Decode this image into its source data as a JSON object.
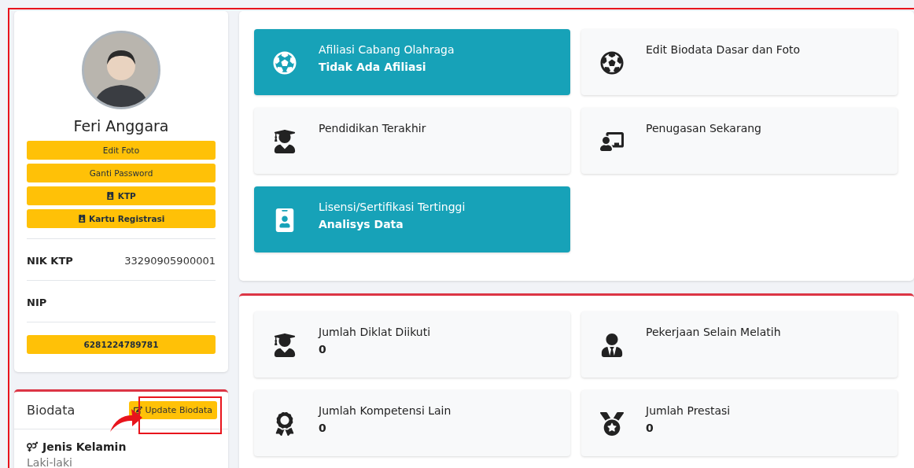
{
  "profile": {
    "name": "Feri Anggara",
    "buttons": [
      {
        "label": "Edit Foto",
        "kind": "plain"
      },
      {
        "label": "Ganti Password",
        "kind": "plain"
      },
      {
        "label": "KTP",
        "kind": "card"
      },
      {
        "label": "Kartu Registrasi",
        "kind": "card"
      }
    ],
    "fields": [
      {
        "label": "NIK KTP",
        "value": "33290905900001"
      },
      {
        "label": "NIP"
      }
    ],
    "phone": "6281224789781"
  },
  "biodata": {
    "title": "Biodata",
    "update_button": "Update Biodata",
    "items": [
      {
        "label": "Jenis Kelamin",
        "value": "Laki-laki"
      }
    ]
  },
  "summary_tiles": [
    {
      "title": "Afiliasi Cabang Olahraga",
      "value": "Tidak Ada Afiliasi",
      "highlighted": true
    },
    {
      "title": "Edit Biodata Dasar dan Foto",
      "highlighted": false
    },
    {
      "title": "Pendidikan Terakhir",
      "highlighted": false
    },
    {
      "title": "Penugasan Sekarang",
      "highlighted": false
    },
    {
      "title": "Lisensi/Sertifikasi Tertinggi",
      "value": "Analisys Data",
      "highlighted": true
    }
  ],
  "stat_tiles": [
    {
      "title": "Jumlah Diklat Diikuti",
      "value": "0",
      "highlighted": false
    },
    {
      "title": "Pekerjaan Selain Melatih",
      "highlighted": false
    },
    {
      "title": "Jumlah Kompetensi Lain",
      "value": "0",
      "highlighted": false
    },
    {
      "title": "Jumlah Prestasi",
      "value": "0",
      "highlighted": false
    }
  ]
}
